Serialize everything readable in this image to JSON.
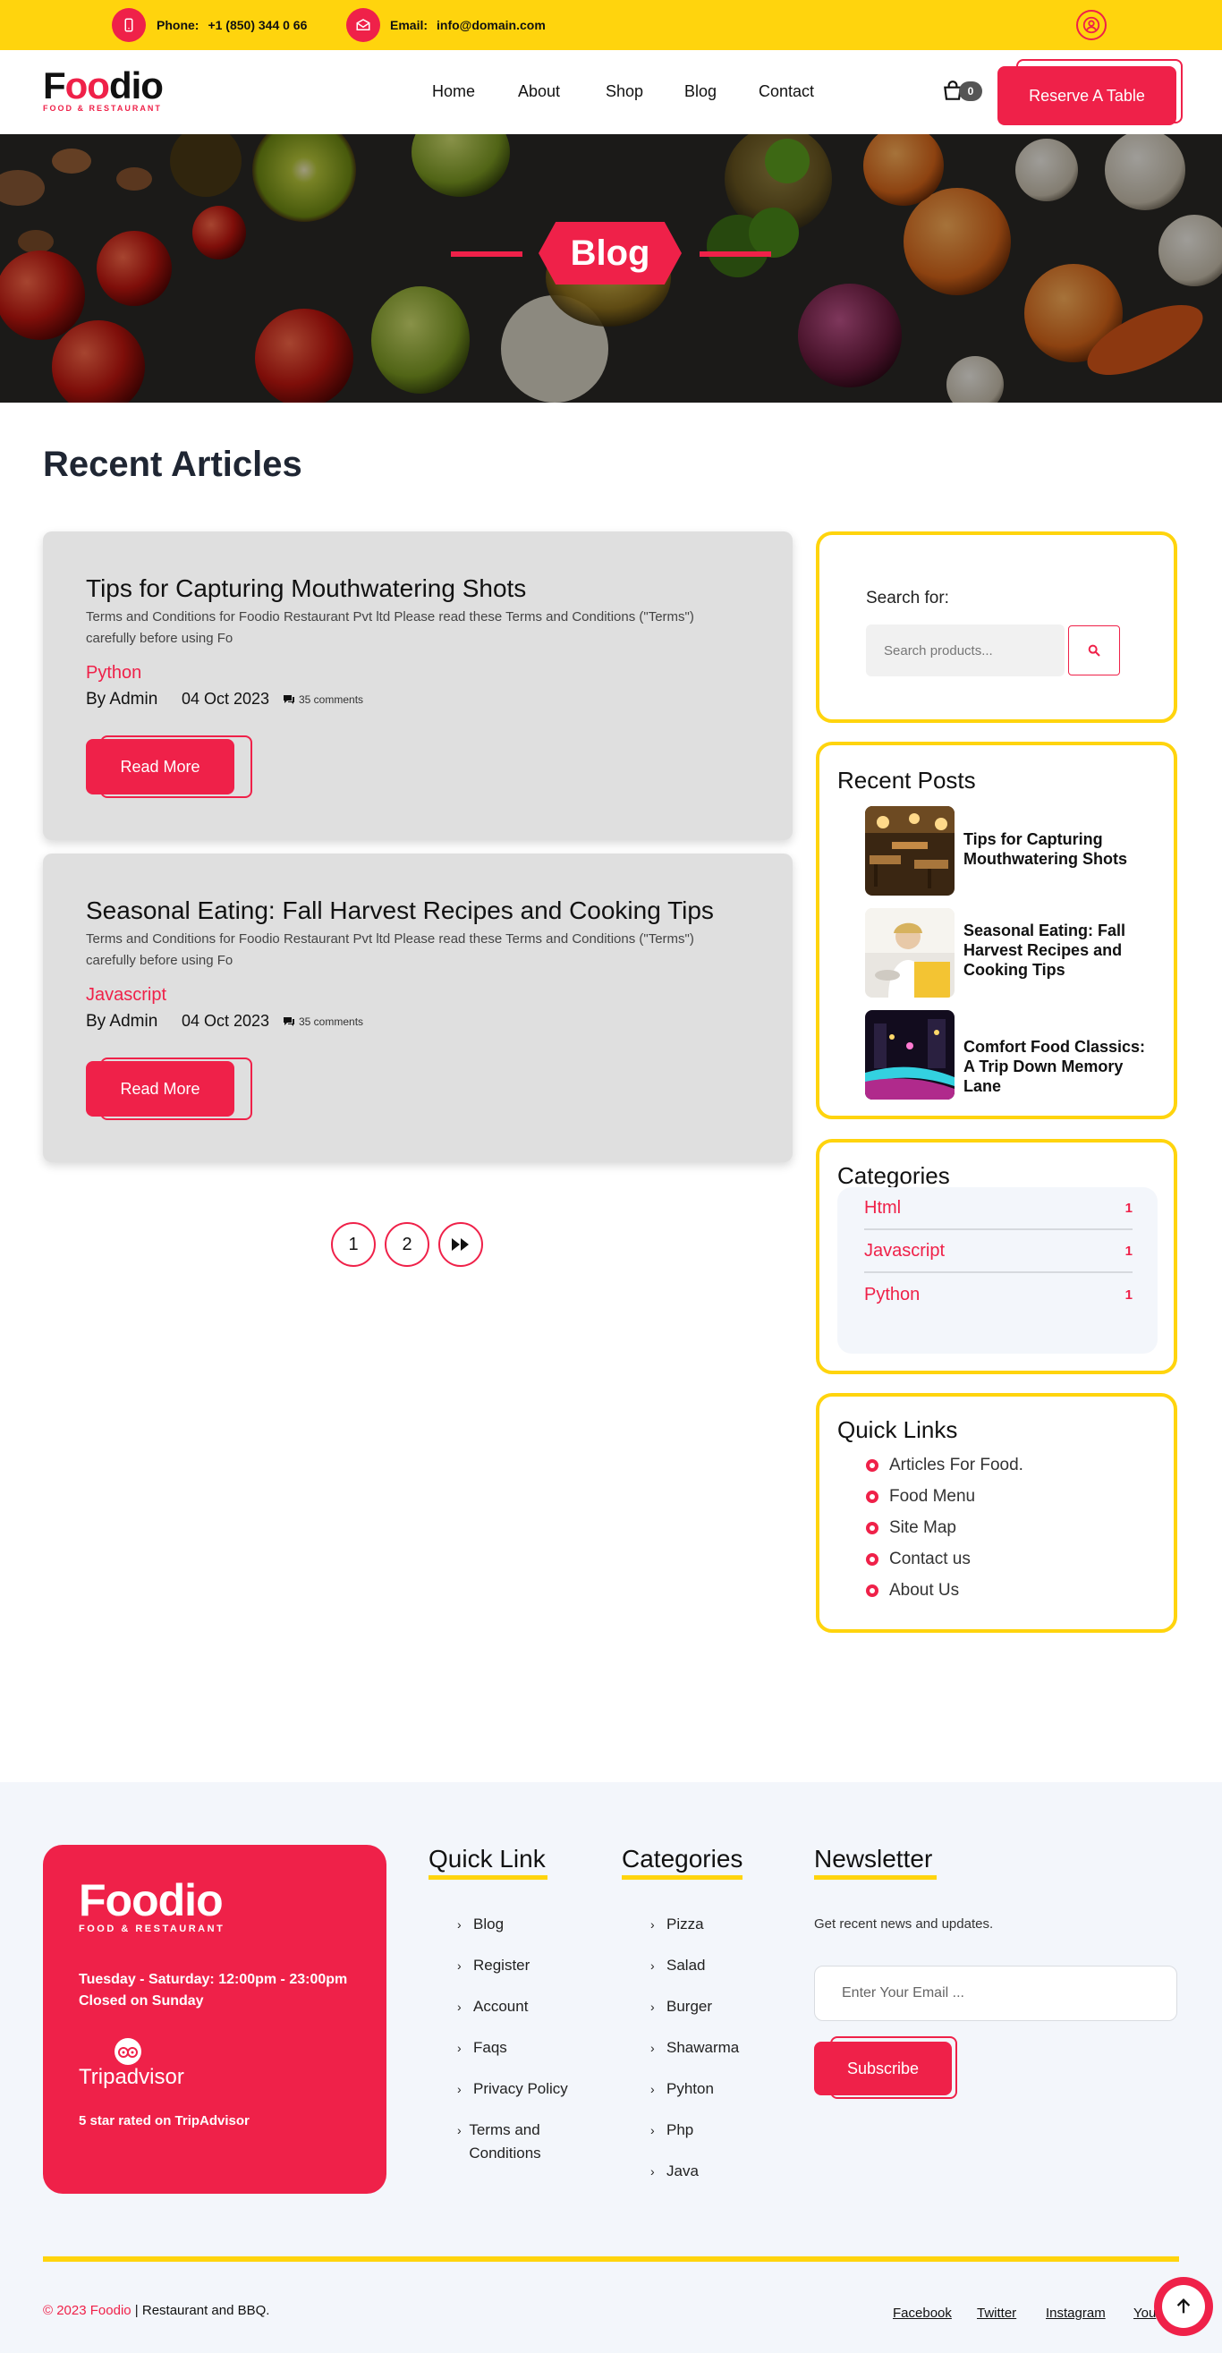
{
  "topbar": {
    "phone_label": "Phone:",
    "phone": "+1 (850) 344 0 66",
    "email_label": "Email:",
    "email": "info@domain.com"
  },
  "header": {
    "logo_main_a": "F",
    "logo_main_oo": "oo",
    "logo_main_b": "dio",
    "logo_sub": "FOOD & RESTAURANT",
    "nav": [
      "Home",
      "About",
      "Shop",
      "Blog",
      "Contact"
    ],
    "cart_count": "0",
    "reserve_label": "Reserve A Table"
  },
  "hero": {
    "title": "Blog"
  },
  "main": {
    "heading": "Recent Articles",
    "articles": [
      {
        "title": "Tips for Capturing Mouthwatering Shots",
        "excerpt": "Terms and Conditions for Foodio Restaurant Pvt ltd Please read these Terms and Conditions (\"Terms\") carefully before using Fo",
        "category": "Python",
        "author": "By Admin",
        "date": "04 Oct 2023",
        "comments": "35 comments",
        "read_more": "Read More"
      },
      {
        "title": "Seasonal Eating: Fall Harvest Recipes and Cooking Tips",
        "excerpt": "Terms and Conditions for Foodio Restaurant Pvt ltd Please read these Terms and Conditions (\"Terms\") carefully before using Fo",
        "category": "Javascript",
        "author": "By Admin",
        "date": "04 Oct 2023",
        "comments": "35 comments",
        "read_more": "Read More"
      }
    ],
    "pagination": [
      "1",
      "2"
    ]
  },
  "sidebar": {
    "search_label": "Search for:",
    "search_placeholder": "Search products...",
    "recent_title": "Recent Posts",
    "recent_posts": [
      "Tips for Capturing Mouthwatering Shots",
      "Seasonal Eating: Fall Harvest Recipes and Cooking Tips",
      "Comfort Food Classics: A Trip Down Memory Lane"
    ],
    "categories_title": "Categories",
    "categories": [
      {
        "name": "Html",
        "count": "1"
      },
      {
        "name": "Javascript",
        "count": "1"
      },
      {
        "name": "Python",
        "count": "1"
      }
    ],
    "quick_title": "Quick Links",
    "quick_links": [
      "Articles For Food.",
      "Food Menu",
      "Site Map",
      "Contact us",
      "About Us"
    ]
  },
  "footer": {
    "brand_main_a": "F",
    "brand_main_oo": "oo",
    "brand_main_b": "dio",
    "brand_sub": "FOOD & RESTAURANT",
    "hours": "Tuesday - Saturday: 12:00pm - 23:00pm",
    "closed": "Closed on Sunday",
    "tripadvisor": "Tripadvisor",
    "rated": "5 star rated on TripAdvisor",
    "quick_title": "Quick Link",
    "quick_links": [
      "Blog",
      "Register",
      "Account",
      "Faqs",
      "Privacy Policy",
      "Terms and Conditions"
    ],
    "cat_title": "Categories",
    "cat_links": [
      "Pizza",
      "Salad",
      "Burger",
      "Shawarma",
      "Pyhton",
      "Php",
      "Java"
    ],
    "news_title": "Newsletter",
    "news_text": "Get recent news and updates.",
    "email_placeholder": "Enter Your Email ...",
    "subscribe": "Subscribe",
    "copy_year": "© 2023 Foodio",
    "copy_rest": " | Restaurant and BBQ.",
    "social": [
      "Facebook",
      "Twitter",
      "Instagram",
      "You"
    ]
  },
  "colors": {
    "brand_red": "#EF2149",
    "brand_yellow": "#FFD40D",
    "footer_bg": "#f3f6fb"
  }
}
